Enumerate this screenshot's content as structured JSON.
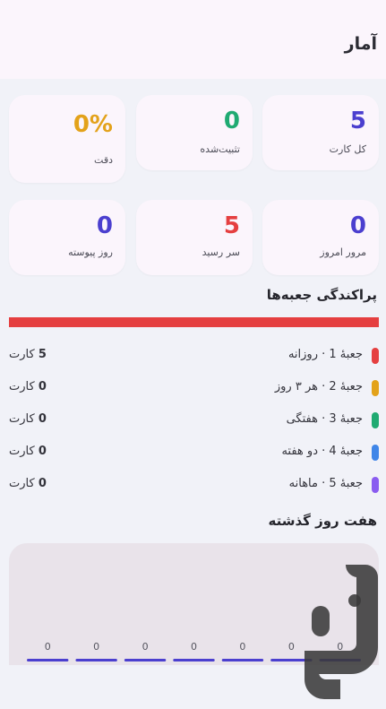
{
  "appbar": {
    "title": "آمار"
  },
  "stats": {
    "total": {
      "value": "5",
      "label": "کل کارت",
      "color": "#4b3fcf"
    },
    "fixed": {
      "value": "0",
      "label": "تثبیت‌شده",
      "color": "#1faa72"
    },
    "accuracy": {
      "value": "0%",
      "label": "دقت",
      "color": "#e3a21a"
    },
    "review_today": {
      "value": "0",
      "label": "مرور امروز",
      "color": "#4b3fcf"
    },
    "due": {
      "value": "5",
      "label": "سر رسید",
      "color": "#e53f40"
    },
    "streak": {
      "value": "0",
      "label": "روز پیوسته",
      "color": "#4b3fcf"
    }
  },
  "distribution": {
    "title": "پراکندگی جعبه‌ها",
    "bar_color": "#e53f40",
    "boxes": [
      {
        "label": "جعبهٔ 1 · روزانه",
        "count": "5",
        "unit": "کارت",
        "color": "#e53f40"
      },
      {
        "label": "جعبهٔ 2 · هر ۳ روز",
        "count": "0",
        "unit": "کارت",
        "color": "#e3a21a"
      },
      {
        "label": "جعبهٔ 3 · هفتگی",
        "count": "0",
        "unit": "کارت",
        "color": "#1faa72"
      },
      {
        "label": "جعبهٔ 4 · دو هفته",
        "count": "0",
        "unit": "کارت",
        "color": "#3f86e8"
      },
      {
        "label": "جعبهٔ 5 · ماهانه",
        "count": "0",
        "unit": "کارت",
        "color": "#8a5cf0"
      }
    ]
  },
  "weekly": {
    "title": "هفت روز گذشته",
    "bar_color": "#4b3fcf"
  },
  "chart_data": {
    "type": "bar",
    "categories": [
      "",
      "",
      "",
      "",
      "",
      "",
      ""
    ],
    "values": [
      0,
      0,
      0,
      0,
      0,
      0,
      0
    ],
    "data_labels": [
      "0",
      "0",
      "0",
      "0",
      "0",
      "0",
      "0"
    ],
    "title": "هفت روز گذشته",
    "xlabel": "",
    "ylabel": "",
    "grid": false
  }
}
